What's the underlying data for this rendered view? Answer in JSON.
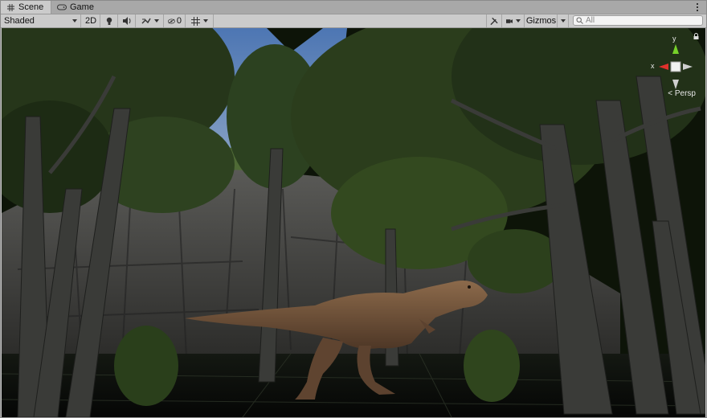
{
  "tabs": [
    {
      "label": "Scene",
      "icon": "scene-grid-icon",
      "active": true
    },
    {
      "label": "Game",
      "icon": "game-controller-icon",
      "active": false
    }
  ],
  "toolbar": {
    "draw_mode": "Shaded",
    "mode_2d": "2D",
    "hidden_count": "0",
    "gizmos_label": "Gizmos",
    "search_placeholder": "All"
  },
  "scene_gizmo": {
    "x_label": "x",
    "y_label": "y",
    "projection": "< Persp"
  },
  "colors": {
    "sky": "#5a7fb6",
    "foliage": "#2f4a1a",
    "trunk": "#3a3b38",
    "dinosaur": "#7a5a3f",
    "x_axis": "#e0312c",
    "y_axis": "#77d12a"
  }
}
